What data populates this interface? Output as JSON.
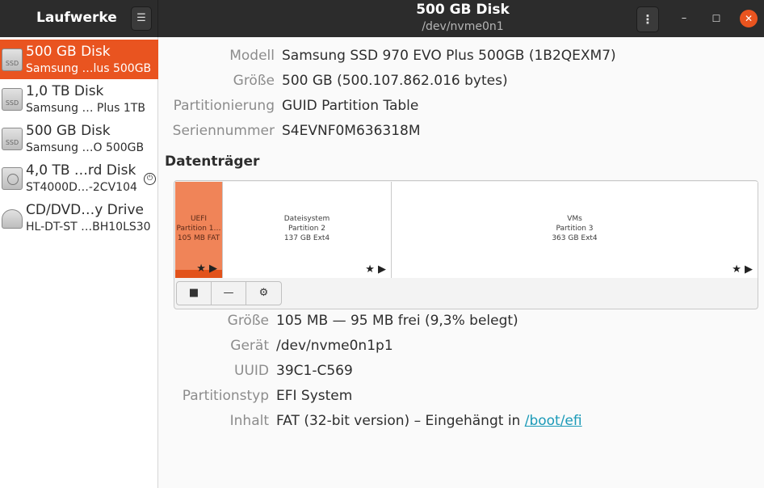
{
  "header": {
    "left_title": "Laufwerke",
    "title": "500 GB Disk",
    "subtitle": "/dev/nvme0n1"
  },
  "sidebar": {
    "items": [
      {
        "name": "500 GB Disk",
        "sub": "Samsung …lus 500GB",
        "icon": "ssd-icon",
        "icon_text": "SSD"
      },
      {
        "name": "1,0 TB Disk",
        "sub": "Samsung … Plus 1TB",
        "icon": "ssd-icon",
        "icon_text": "SSD"
      },
      {
        "name": "500 GB Disk",
        "sub": "Samsung …O 500GB",
        "icon": "ssd-icon",
        "icon_text": "SSD"
      },
      {
        "name": "4,0 TB …rd Disk",
        "sub": "ST4000D…-2CV104",
        "icon": "hdd-icon"
      },
      {
        "name": "CD/DVD…y Drive",
        "sub": "HL-DT-ST …BH10LS30",
        "icon": "optical-drive-icon"
      }
    ]
  },
  "disk_info": {
    "model_label": "Modell",
    "model_value": "Samsung SSD 970 EVO Plus 500GB (1B2QEXM7)",
    "size_label": "Größe",
    "size_value": "500 GB (500.107.862.016 bytes)",
    "partitioning_label": "Partitionierung",
    "partitioning_value": "GUID Partition Table",
    "serial_label": "Seriennummer",
    "serial_value": "S4EVNF0M636318M"
  },
  "volumes": {
    "section_title": "Datenträger",
    "partitions": [
      {
        "line1": "UEFI",
        "line2": "Partition 1…",
        "line3": "105 MB FAT",
        "selected": true
      },
      {
        "line1": "Dateisystem",
        "line2": "Partition 2",
        "line3": "137 GB Ext4",
        "selected": false
      },
      {
        "line1": "VMs",
        "line2": "Partition 3",
        "line3": "363 GB Ext4",
        "selected": false
      }
    ],
    "toolbar": [
      "stop-icon",
      "minus-icon",
      "gears-icon"
    ]
  },
  "partition_info": {
    "size_label": "Größe",
    "size_value": "105 MB — 95 MB frei (9,3% belegt)",
    "device_label": "Gerät",
    "device_value": "/dev/nvme0n1p1",
    "uuid_label": "UUID",
    "uuid_value": "39C1-C569",
    "type_label": "Partitionstyp",
    "type_value": "EFI System",
    "content_label": "Inhalt",
    "content_value": "FAT (32-bit version) – Eingehängt in ",
    "content_link": "/boot/efi"
  },
  "colors": {
    "accent": "#e95420",
    "selected_partition": "#f08458",
    "close_button": "#e9541f",
    "link": "#1b9ab8"
  }
}
